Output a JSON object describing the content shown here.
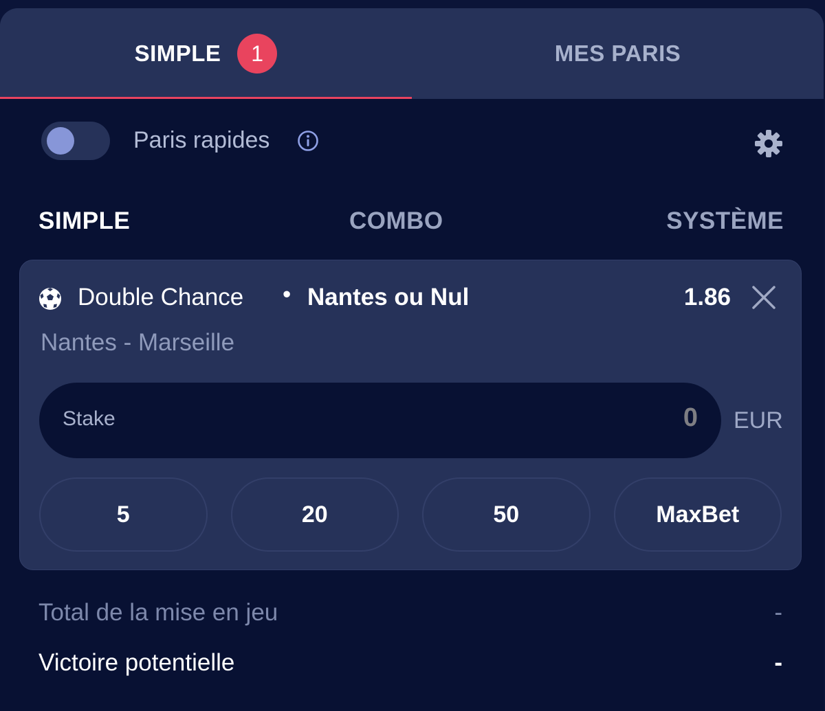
{
  "tabs": {
    "simple_label": "SIMPLE",
    "simple_badge": "1",
    "my_bets_label": "MES PARIS"
  },
  "quick_bets": {
    "label": "Paris rapides",
    "enabled": false
  },
  "bet_types": {
    "simple": "SIMPLE",
    "combo": "COMBO",
    "system": "SYSTÈME"
  },
  "selection": {
    "market": "Double Chance",
    "separator": "•",
    "pick": "Nantes ou Nul",
    "odds": "1.86",
    "match": "Nantes - Marseille",
    "stake_placeholder": "Stake",
    "stake_value": "0",
    "currency": "EUR",
    "quick_stakes": [
      "5",
      "20",
      "50",
      "MaxBet"
    ]
  },
  "summary": {
    "total_label": "Total de la mise en jeu",
    "total_value": "-",
    "win_label": "Victoire potentielle",
    "win_value": "-"
  },
  "colors": {
    "background": "#081133",
    "panel": "#263259",
    "accent": "#e9445e",
    "toggle_knob": "#8796d8"
  }
}
